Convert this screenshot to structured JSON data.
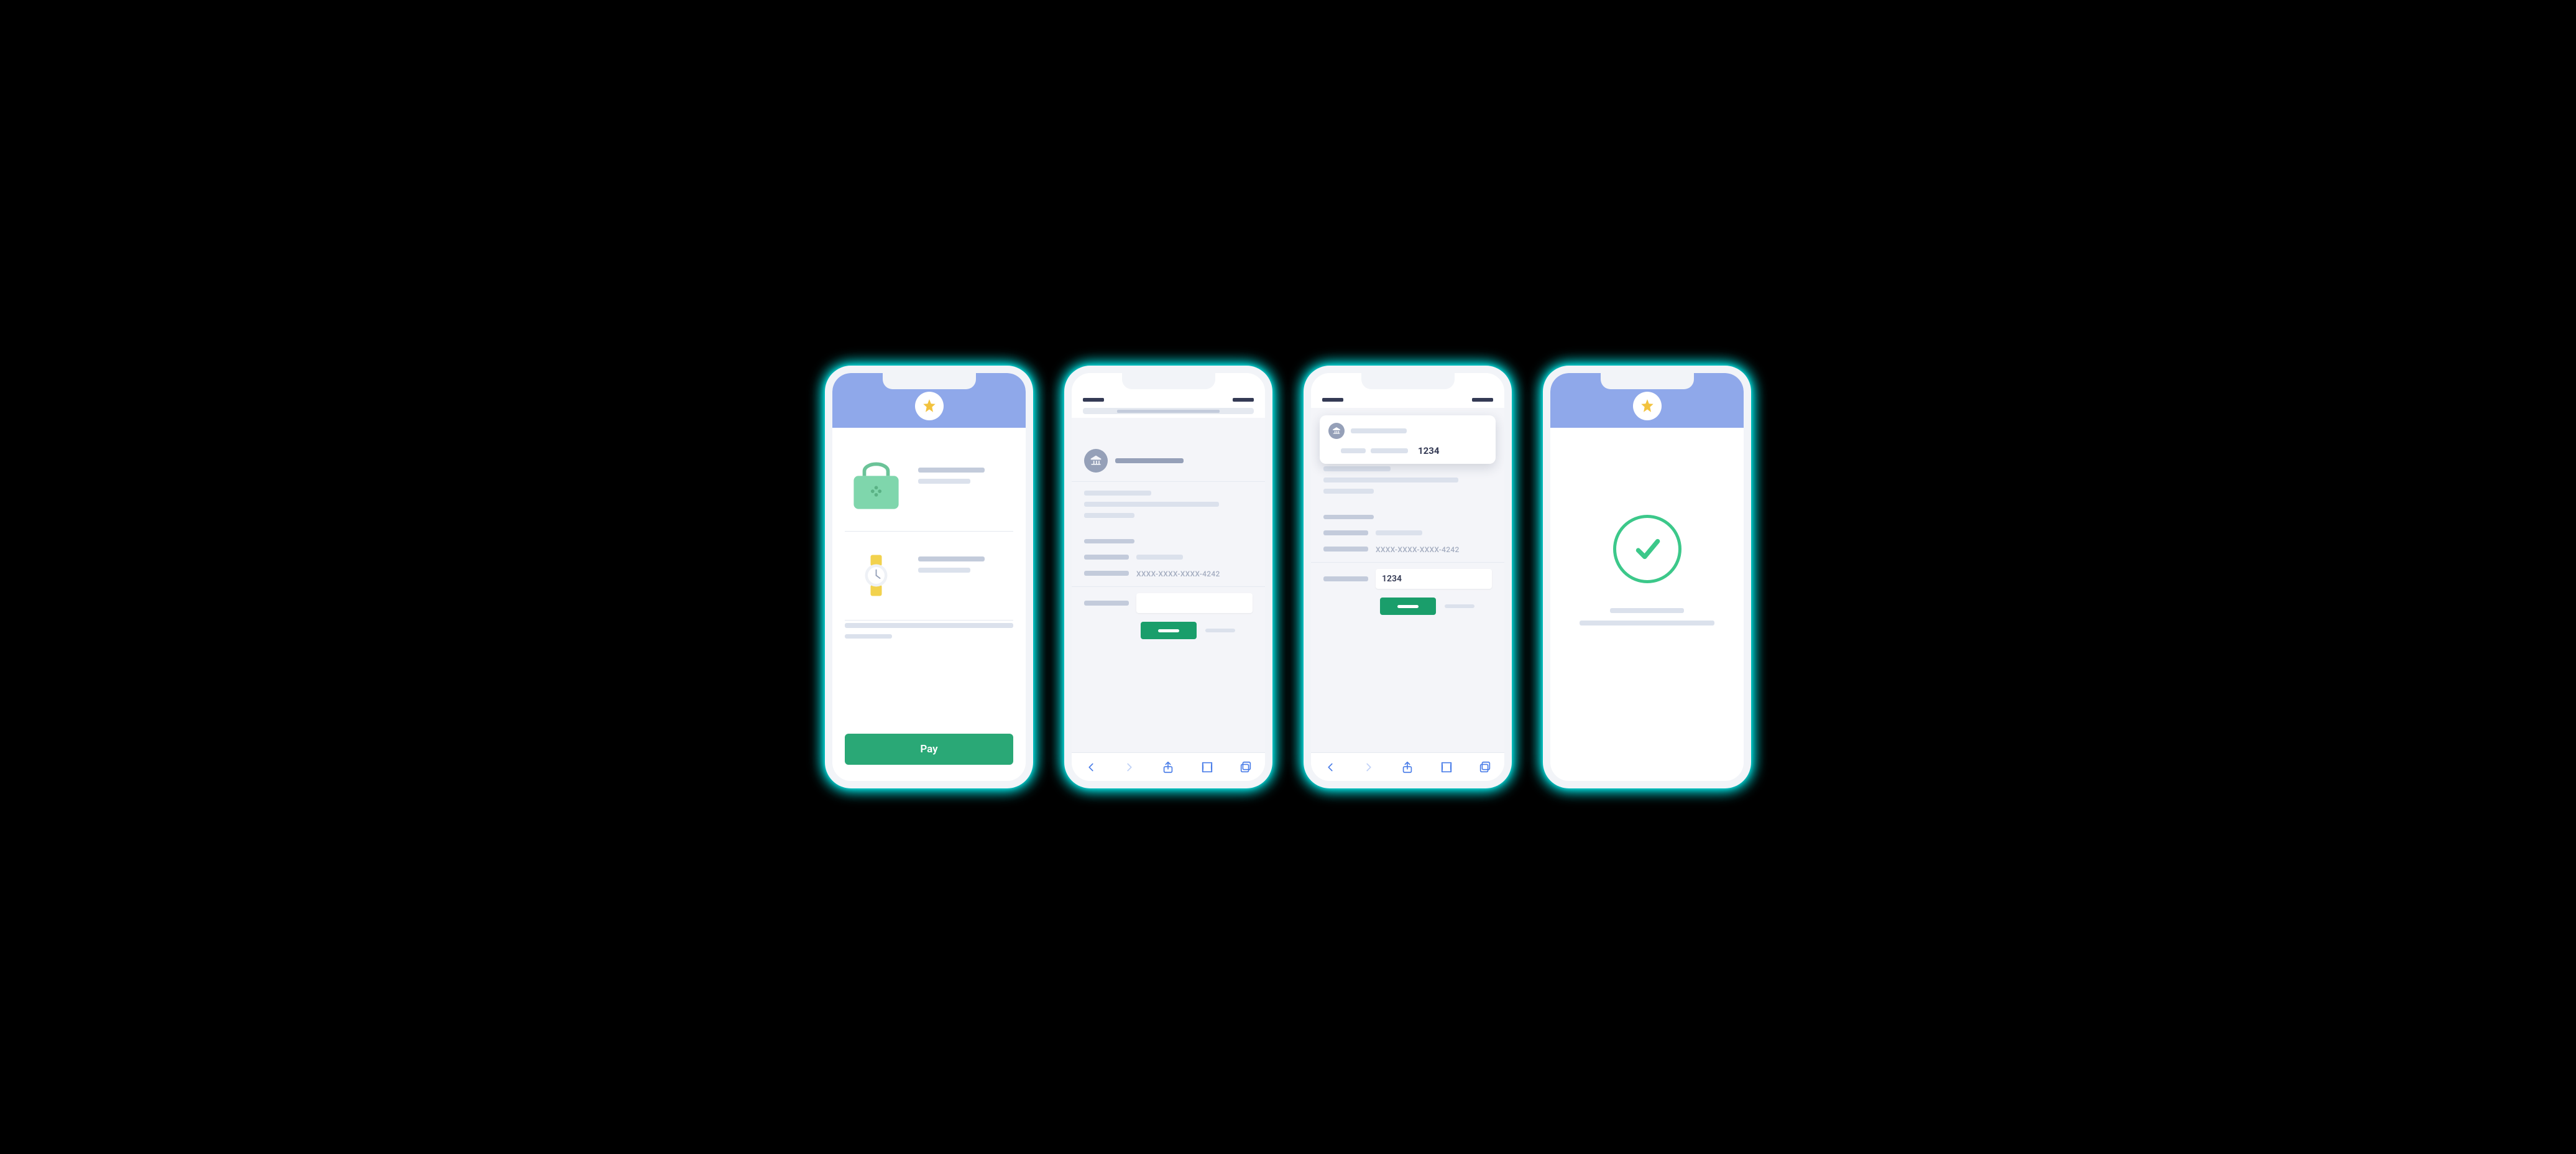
{
  "colors": {
    "accent_blue": "#8fa8ea",
    "accent_green": "#2aa876",
    "neon": "#00e5e5",
    "star": "#f2c23d"
  },
  "phone1": {
    "pay_button_label": "Pay"
  },
  "phone2": {
    "card_placeholder": "XXXX-XXXX-XXXX-4242",
    "code_value": ""
  },
  "phone3": {
    "card_placeholder": "XXXX-XXXX-XXXX-4242",
    "code_value": "1234",
    "notification_code": "1234"
  },
  "phone4": {
    "status": "success"
  }
}
